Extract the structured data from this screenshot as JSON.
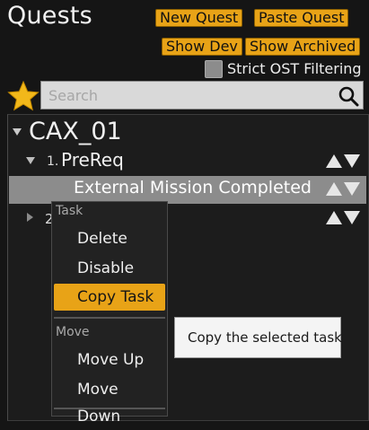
{
  "header": {
    "title": "Quests",
    "buttons": {
      "new_quest": "New Quest",
      "paste_quest": "Paste Quest",
      "show_dev": "Show Dev",
      "show_archived": "Show Archived"
    },
    "strict_ost": {
      "label": "Strict OST Filtering",
      "checked": false
    }
  },
  "search": {
    "placeholder": "Search",
    "icon": "search-icon"
  },
  "favorite_icon": "star-icon",
  "tree": {
    "root": {
      "label": "CAX_01",
      "expanded": true
    },
    "items": [
      {
        "number": "1.",
        "label": "PreReq",
        "expanded": true
      },
      {
        "label": "External Mission Completed",
        "selected": true
      },
      {
        "number": "2",
        "expanded": false
      }
    ]
  },
  "context_menu": {
    "sections": [
      {
        "header": "Task",
        "items": [
          "Delete",
          "Disable",
          "Copy Task"
        ]
      },
      {
        "header": "Move",
        "items": [
          "Move Up",
          "Move Down"
        ]
      }
    ],
    "highlighted": "Copy Task"
  },
  "tooltip": "Copy the selected task",
  "colors": {
    "accent": "#e8a317",
    "background": "#151515",
    "selected_row": "#8c8c8c",
    "star": "#f2b81a"
  }
}
